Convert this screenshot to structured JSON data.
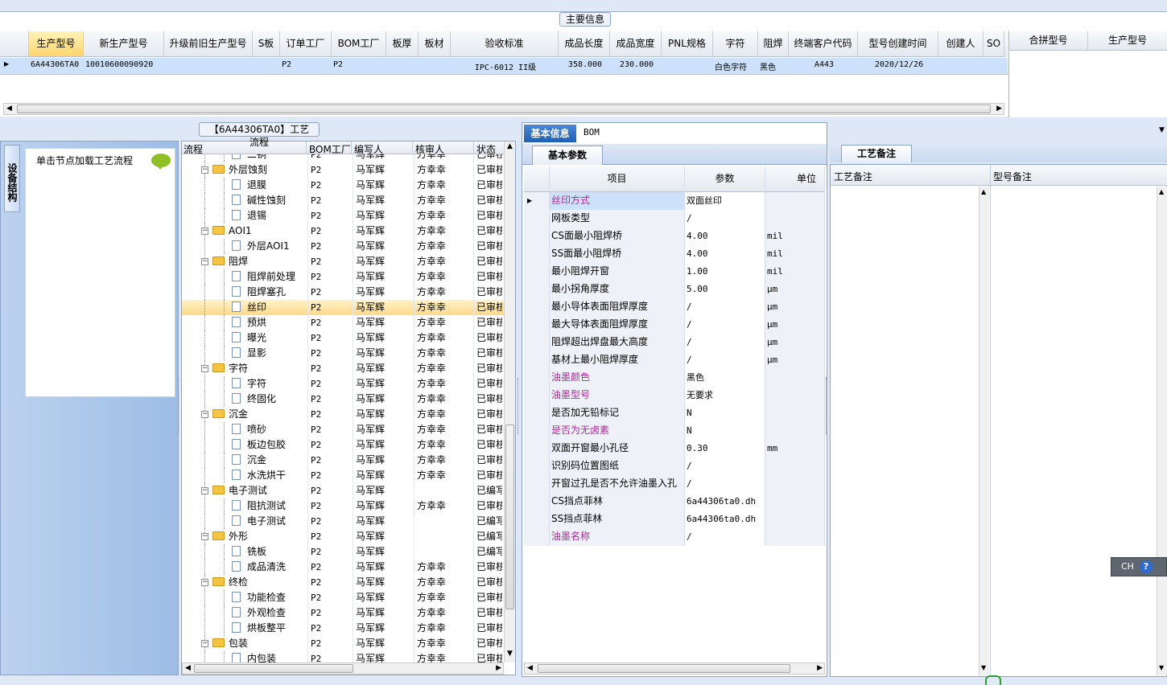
{
  "top": {
    "group_title": "主要信息",
    "columns": [
      "生产型号",
      "新生产型号",
      "升级前旧生产型号",
      "S板",
      "订单工厂",
      "BOM工厂",
      "板厚",
      "板材",
      "验收标准",
      "成品长度",
      "成品宽度",
      "PNL规格",
      "字符",
      "阻焊",
      "终端客户代码",
      "型号创建时间",
      "创建人",
      "SO"
    ],
    "row": [
      "6A44306TA0",
      "10010600090920",
      "",
      "",
      "P2",
      "P2",
      "",
      "",
      "IPC-6012 II级",
      "358.000",
      "230.000",
      "",
      "白色字符",
      "黑色",
      "A443",
      "2020/12/26",
      "",
      ""
    ],
    "side_columns": [
      "合拼型号",
      "生产型号"
    ]
  },
  "left": {
    "vertical_tab": "设备结构",
    "hint": "单击节点加载工艺流程"
  },
  "tree": {
    "group_title": "【6A44306TA0】工艺流程",
    "headers": [
      "流程",
      "BOM工厂",
      "编写人",
      "核审人",
      "状态"
    ],
    "rows": [
      {
        "name": "二铜",
        "level": 2,
        "type": "doc",
        "bom": "P2",
        "writer": "马军辉",
        "reviewer": "方幸幸",
        "status": "已审核"
      },
      {
        "name": "外层蚀刻",
        "level": 1,
        "type": "folder",
        "bom": "P2",
        "writer": "马军辉",
        "reviewer": "方幸幸",
        "status": "已审核"
      },
      {
        "name": "退膜",
        "level": 2,
        "type": "doc",
        "bom": "P2",
        "writer": "马军辉",
        "reviewer": "方幸幸",
        "status": "已审核"
      },
      {
        "name": "碱性蚀刻",
        "level": 2,
        "type": "doc",
        "bom": "P2",
        "writer": "马军辉",
        "reviewer": "方幸幸",
        "status": "已审核"
      },
      {
        "name": "退锡",
        "level": 2,
        "type": "doc",
        "bom": "P2",
        "writer": "马军辉",
        "reviewer": "方幸幸",
        "status": "已审核"
      },
      {
        "name": "AOI1",
        "level": 1,
        "type": "folder",
        "bom": "P2",
        "writer": "马军辉",
        "reviewer": "方幸幸",
        "status": "已审核"
      },
      {
        "name": "外层AOI1",
        "level": 2,
        "type": "doc",
        "bom": "P2",
        "writer": "马军辉",
        "reviewer": "方幸幸",
        "status": "已审核"
      },
      {
        "name": "阻焊",
        "level": 1,
        "type": "folder",
        "bom": "P2",
        "writer": "马军辉",
        "reviewer": "方幸幸",
        "status": "已审核"
      },
      {
        "name": "阻焊前处理",
        "level": 2,
        "type": "doc",
        "bom": "P2",
        "writer": "马军辉",
        "reviewer": "方幸幸",
        "status": "已审核"
      },
      {
        "name": "阻焊塞孔",
        "level": 2,
        "type": "doc",
        "bom": "P2",
        "writer": "马军辉",
        "reviewer": "方幸幸",
        "status": "已审核"
      },
      {
        "name": "丝印",
        "level": 2,
        "type": "doc",
        "bom": "P2",
        "writer": "马军辉",
        "reviewer": "方幸幸",
        "status": "已审核",
        "selected": true
      },
      {
        "name": "预烘",
        "level": 2,
        "type": "doc",
        "bom": "P2",
        "writer": "马军辉",
        "reviewer": "方幸幸",
        "status": "已审核"
      },
      {
        "name": "曝光",
        "level": 2,
        "type": "doc",
        "bom": "P2",
        "writer": "马军辉",
        "reviewer": "方幸幸",
        "status": "已审核"
      },
      {
        "name": "显影",
        "level": 2,
        "type": "doc",
        "bom": "P2",
        "writer": "马军辉",
        "reviewer": "方幸幸",
        "status": "已审核"
      },
      {
        "name": "字符",
        "level": 1,
        "type": "folder",
        "bom": "P2",
        "writer": "马军辉",
        "reviewer": "方幸幸",
        "status": "已审核"
      },
      {
        "name": "字符",
        "level": 2,
        "type": "doc",
        "bom": "P2",
        "writer": "马军辉",
        "reviewer": "方幸幸",
        "status": "已审核"
      },
      {
        "name": "终固化",
        "level": 2,
        "type": "doc",
        "bom": "P2",
        "writer": "马军辉",
        "reviewer": "方幸幸",
        "status": "已审核"
      },
      {
        "name": "沉金",
        "level": 1,
        "type": "folder",
        "bom": "P2",
        "writer": "马军辉",
        "reviewer": "方幸幸",
        "status": "已审核"
      },
      {
        "name": "喷砂",
        "level": 2,
        "type": "doc",
        "bom": "P2",
        "writer": "马军辉",
        "reviewer": "方幸幸",
        "status": "已审核"
      },
      {
        "name": "板边包胶",
        "level": 2,
        "type": "doc",
        "bom": "P2",
        "writer": "马军辉",
        "reviewer": "方幸幸",
        "status": "已审核"
      },
      {
        "name": "沉金",
        "level": 2,
        "type": "doc",
        "bom": "P2",
        "writer": "马军辉",
        "reviewer": "方幸幸",
        "status": "已审核"
      },
      {
        "name": "水洗烘干",
        "level": 2,
        "type": "doc",
        "bom": "P2",
        "writer": "马军辉",
        "reviewer": "方幸幸",
        "status": "已审核"
      },
      {
        "name": "电子测试",
        "level": 1,
        "type": "folder",
        "bom": "P2",
        "writer": "马军辉",
        "reviewer": "",
        "status": "已编写"
      },
      {
        "name": "阻抗测试",
        "level": 2,
        "type": "doc",
        "bom": "P2",
        "writer": "马军辉",
        "reviewer": "方幸幸",
        "status": "已审核"
      },
      {
        "name": "电子测试",
        "level": 2,
        "type": "doc",
        "bom": "P2",
        "writer": "马军辉",
        "reviewer": "",
        "status": "已编写"
      },
      {
        "name": "外形",
        "level": 1,
        "type": "folder",
        "bom": "P2",
        "writer": "马军辉",
        "reviewer": "",
        "status": "已编写"
      },
      {
        "name": "铣板",
        "level": 2,
        "type": "doc",
        "bom": "P2",
        "writer": "马军辉",
        "reviewer": "",
        "status": "已编写"
      },
      {
        "name": "成品清洗",
        "level": 2,
        "type": "doc",
        "bom": "P2",
        "writer": "马军辉",
        "reviewer": "方幸幸",
        "status": "已审核"
      },
      {
        "name": "终检",
        "level": 1,
        "type": "folder",
        "bom": "P2",
        "writer": "马军辉",
        "reviewer": "方幸幸",
        "status": "已审核"
      },
      {
        "name": "功能检查",
        "level": 2,
        "type": "doc",
        "bom": "P2",
        "writer": "马军辉",
        "reviewer": "方幸幸",
        "status": "已审核"
      },
      {
        "name": "外观检查",
        "level": 2,
        "type": "doc",
        "bom": "P2",
        "writer": "马军辉",
        "reviewer": "方幸幸",
        "status": "已审核"
      },
      {
        "name": "烘板整平",
        "level": 2,
        "type": "doc",
        "bom": "P2",
        "writer": "马军辉",
        "reviewer": "方幸幸",
        "status": "已审核"
      },
      {
        "name": "包装",
        "level": 1,
        "type": "folder",
        "bom": "P2",
        "writer": "马军辉",
        "reviewer": "方幸幸",
        "status": "已审核"
      },
      {
        "name": "内包装",
        "level": 2,
        "type": "doc",
        "bom": "P2",
        "writer": "马军辉",
        "reviewer": "方幸幸",
        "status": "已审核"
      }
    ]
  },
  "mid": {
    "tabs": [
      "基本信息",
      "BOM"
    ],
    "subtab": "基本参数",
    "headers": [
      "项目",
      "参数",
      "单位"
    ],
    "rows": [
      {
        "item": "丝印方式",
        "value": "双面丝印",
        "unit": "",
        "purple": true
      },
      {
        "item": "网板类型",
        "value": "/",
        "unit": ""
      },
      {
        "item": "CS面最小阻焊桥",
        "value": "4.00",
        "unit": "mil"
      },
      {
        "item": "SS面最小阻焊桥",
        "value": "4.00",
        "unit": "mil"
      },
      {
        "item": "最小阻焊开窗",
        "value": "1.00",
        "unit": "mil"
      },
      {
        "item": "最小拐角厚度",
        "value": "5.00",
        "unit": "μm"
      },
      {
        "item": "最小导体表面阻焊厚度",
        "value": "/",
        "unit": "μm"
      },
      {
        "item": "最大导体表面阻焊厚度",
        "value": "/",
        "unit": "μm"
      },
      {
        "item": "阻焊超出焊盘最大高度",
        "value": "/",
        "unit": "μm"
      },
      {
        "item": "基材上最小阻焊厚度",
        "value": "/",
        "unit": "μm"
      },
      {
        "item": "油墨颜色",
        "value": "黑色",
        "unit": "",
        "purple": true
      },
      {
        "item": "油墨型号",
        "value": "无要求",
        "unit": "",
        "purple": true
      },
      {
        "item": "是否加无铅标记",
        "value": "N",
        "unit": ""
      },
      {
        "item": "是否为无卤素",
        "value": "N",
        "unit": "",
        "purple": true
      },
      {
        "item": "双面开窗最小孔径",
        "value": "0.30",
        "unit": "mm"
      },
      {
        "item": "识别码位置图纸",
        "value": "/",
        "unit": ""
      },
      {
        "item": "开窗过孔是否不允许油墨入孔",
        "value": "/",
        "unit": ""
      },
      {
        "item": "CS挡点菲林",
        "value": "6a44306ta0.dh",
        "unit": ""
      },
      {
        "item": "SS挡点菲林",
        "value": "6a44306ta0.dh",
        "unit": ""
      },
      {
        "item": "油墨名称",
        "value": "/",
        "unit": "",
        "purple": true
      }
    ]
  },
  "right": {
    "tab": "工艺备注",
    "col1": "工艺备注",
    "col2": "型号备注"
  },
  "ime": {
    "label": "CH"
  },
  "colors": {
    "purple": "#b0279b",
    "accent": "#1d5fb3",
    "selection_row": "#cde2fa",
    "selection_tree": "#ffd98a"
  }
}
